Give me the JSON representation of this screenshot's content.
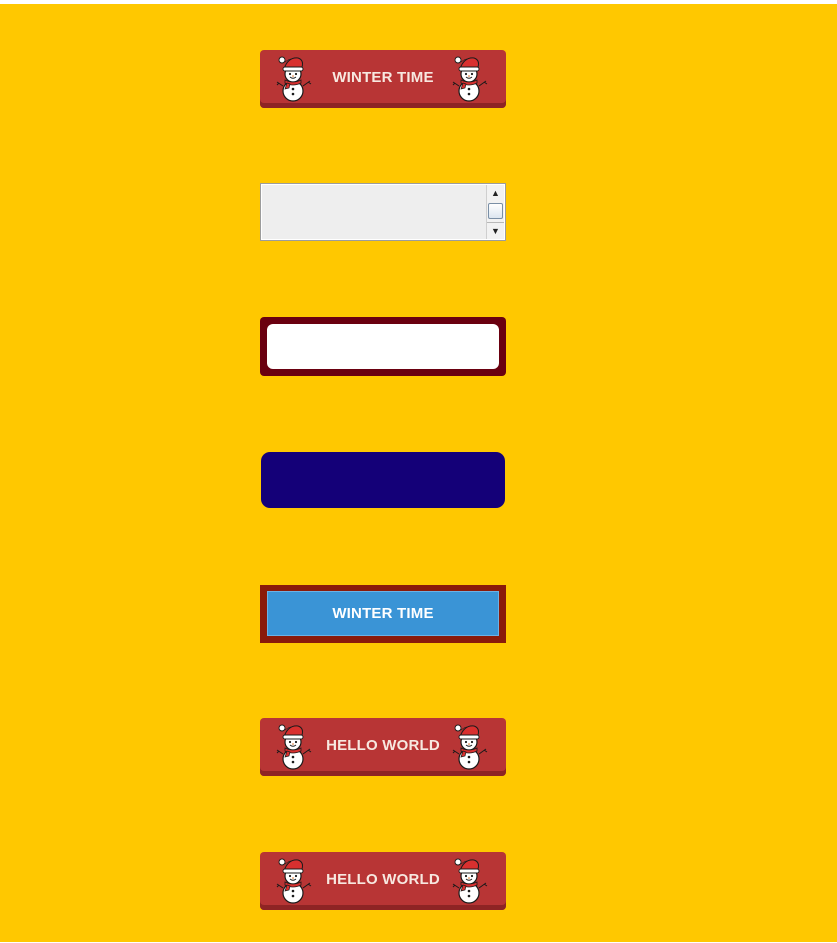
{
  "colors": {
    "background": "#FFC800",
    "snow_button": "#B83535",
    "framed_input_border": "#6A0010",
    "navy_field": "#140078",
    "blue_button": "#3A94D6",
    "blue_button_frame": "#8A1A0A"
  },
  "buttons": {
    "winter_time_1": {
      "label": "WINTER TIME",
      "left_icon": "snowman-icon",
      "right_icon": "snowman-icon"
    },
    "winter_time_blue": {
      "label": "WINTER TIME"
    },
    "hello_world_1": {
      "label": "HELLO WORLD",
      "left_icon": "snowman-icon",
      "right_icon": "snowman-icon"
    },
    "hello_world_2": {
      "label": "HELLO WORLD",
      "left_icon": "snowman-icon",
      "right_icon": "snowman-icon"
    }
  },
  "text_area": {
    "value": "",
    "scroll_up_icon": "arrow-up-icon",
    "scroll_down_icon": "arrow-down-icon"
  },
  "framed_input": {
    "value": "",
    "placeholder": ""
  },
  "navy_field": {
    "value": ""
  }
}
